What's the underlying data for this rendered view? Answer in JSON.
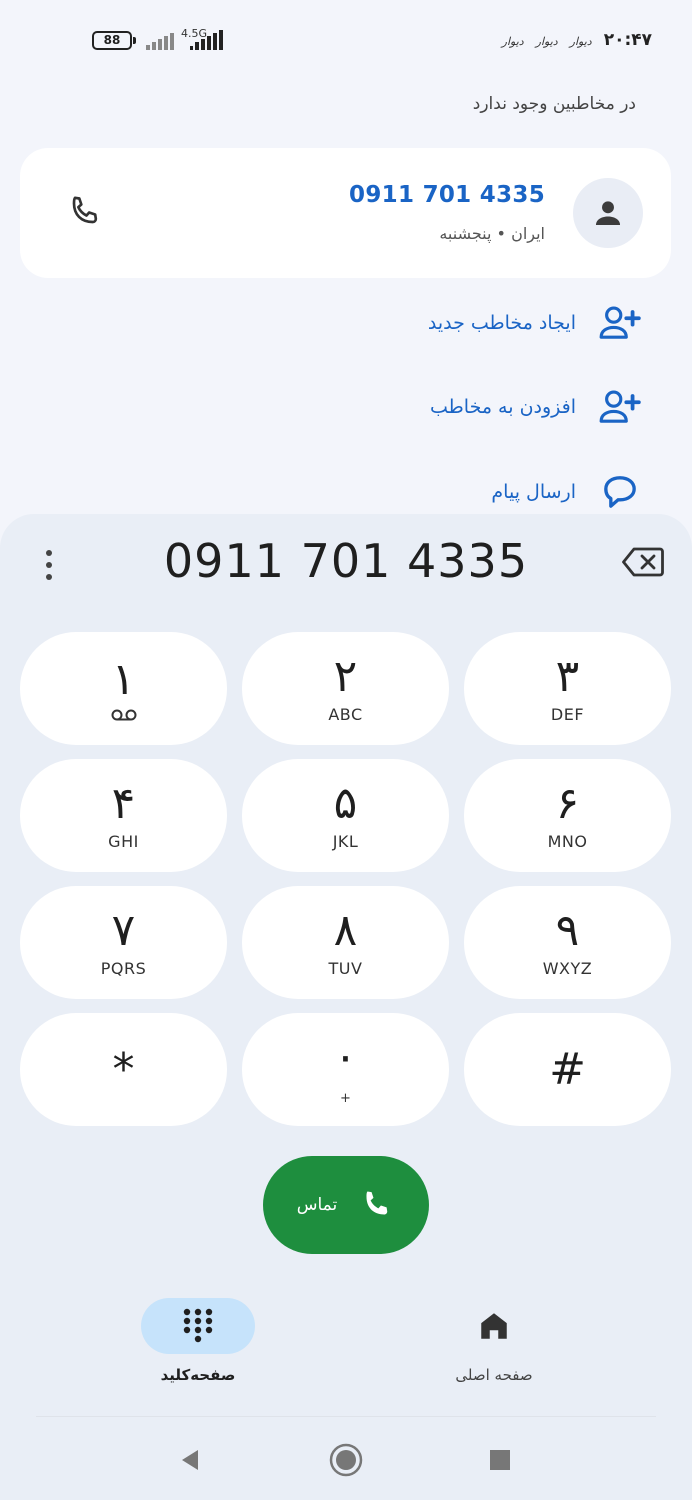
{
  "status_bar": {
    "battery": "88",
    "network": "4.5G",
    "time": "۲۰:۴۷",
    "app_notifications": [
      "دیوار",
      "دیوار",
      "دیوار"
    ]
  },
  "search": {
    "no_contacts_text": "در مخاطبین وجود ندارد"
  },
  "result": {
    "number": "0911 701 4335",
    "subtitle": "ایران • پنجشنبه"
  },
  "actions": [
    {
      "label": "ایجاد مخاطب جدید",
      "icon": "person-add-icon"
    },
    {
      "label": "افزودن به مخاطب",
      "icon": "person-add-icon"
    },
    {
      "label": "ارسال پیام",
      "icon": "message-icon"
    }
  ],
  "dialpad": {
    "number": "0911 701 4335",
    "keys": [
      {
        "digit": "۱",
        "letters": ""
      },
      {
        "digit": "۲",
        "letters": "ABC"
      },
      {
        "digit": "۳",
        "letters": "DEF"
      },
      {
        "digit": "۴",
        "letters": "GHI"
      },
      {
        "digit": "۵",
        "letters": "JKL"
      },
      {
        "digit": "۶",
        "letters": "MNO"
      },
      {
        "digit": "۷",
        "letters": "PQRS"
      },
      {
        "digit": "۸",
        "letters": "TUV"
      },
      {
        "digit": "۹",
        "letters": "WXYZ"
      },
      {
        "digit": "*",
        "letters": ""
      },
      {
        "digit": "۰",
        "letters": "+"
      },
      {
        "digit": "#",
        "letters": ""
      }
    ],
    "call_label": "تماس"
  },
  "bottom_nav": {
    "keypad_label": "صفحه‌کلید",
    "home_label": "صفحه اصلی"
  },
  "colors": {
    "accent_blue": "#1a64c5",
    "call_green": "#1e8e3e",
    "active_pill": "#c6e3fb"
  }
}
